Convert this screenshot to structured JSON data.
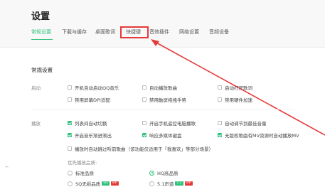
{
  "page": {
    "title": "设置",
    "tabs": [
      {
        "label": "常规设置",
        "active": true
      },
      {
        "label": "下载与缓存",
        "active": false
      },
      {
        "label": "桌面歌词",
        "active": false
      },
      {
        "label": "快捷键",
        "active": false,
        "highlighted": true
      },
      {
        "label": "音效插件",
        "active": false
      },
      {
        "label": "网络设置",
        "active": false
      },
      {
        "label": "音频设备",
        "active": false
      }
    ]
  },
  "general": {
    "section_title": "常规设置",
    "startup": {
      "label": "启动",
      "options": [
        {
          "label": "开机自动启动QQ音乐",
          "checked": false
        },
        {
          "label": "自动播放歌曲",
          "checked": false
        },
        {
          "label": "启动打开歌词",
          "checked": false
        },
        {
          "label": "禁用屏幕DPI适配",
          "checked": false
        },
        {
          "label": "禁用触屏拖拽手势",
          "checked": false
        },
        {
          "label": "禁用硬件加速",
          "checked": false
        }
      ]
    },
    "playback": {
      "label": "播放",
      "options": [
        {
          "label": "列表间自动切换",
          "checked": true
        },
        {
          "label": "开启手机遥控电脑播歌",
          "checked": false
        },
        {
          "label": "自动调节到最佳音量",
          "checked": false
        },
        {
          "label": "开启音乐渐进渐出",
          "checked": true
        },
        {
          "label": "响应多媒体键盘",
          "checked": true
        },
        {
          "label": "无版权歌曲有MV资源时自动播放MV",
          "checked": true
        },
        {
          "label": "播放时自动跳过听前歌曲（该功能仅适用于「我喜欢」等部分场景）",
          "checked": false
        }
      ],
      "quality_label": "优先播放品质:",
      "quality_options": [
        {
          "label": "标准品质",
          "selected": false,
          "badges": []
        },
        {
          "label": "HQ高品质",
          "selected": true,
          "badges": []
        },
        {
          "label": "SQ无损品质",
          "selected": false,
          "badges": [
            {
              "text": "SQ",
              "color": "#31c27c"
            },
            {
              "text": "VIP",
              "color": "#e53a3a"
            }
          ]
        },
        {
          "label": "5.1声道",
          "selected": false,
          "badges": [
            {
              "text": "5.1",
              "color": "#31c27c"
            },
            {
              "text": "VIP",
              "color": "#e53a3a"
            }
          ]
        }
      ]
    }
  },
  "colors": {
    "accent": "#31c27c",
    "annotation": "#e53a3a"
  }
}
